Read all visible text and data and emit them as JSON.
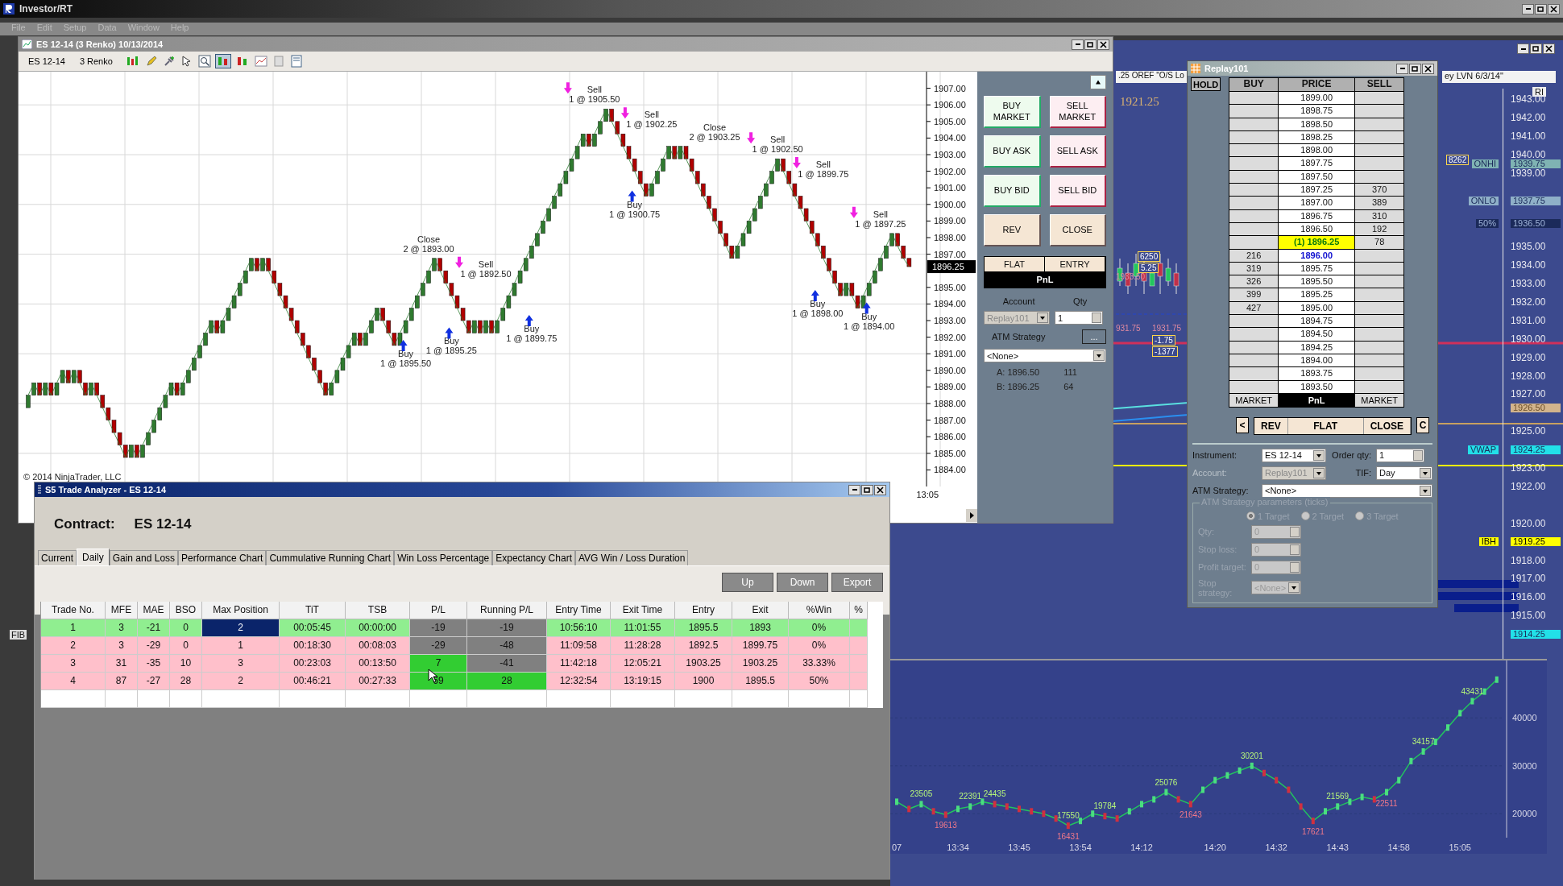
{
  "app": {
    "title": "Investor/RT",
    "menu": [
      "File",
      "Edit",
      "Setup",
      "Data",
      "Window",
      "Help"
    ],
    "side_label": "FIB"
  },
  "chart_window": {
    "title": "ES 12-14 (3 Renko)  10/13/2014",
    "instrument": "ES 12-14",
    "period": "3 Renko",
    "copyright": "© 2014 NinjaTrader, LLC",
    "time_label": "13:05",
    "last_price": "1896.25",
    "chart_data": {
      "type": "line",
      "ylim": [
        1883,
        1908
      ],
      "grid": true,
      "yticks": [
        {
          "value": 1907,
          "label": "1907.00"
        },
        {
          "value": 1906,
          "label": "1906.00"
        },
        {
          "value": 1905,
          "label": "1905.00"
        },
        {
          "value": 1904,
          "label": "1904.00"
        },
        {
          "value": 1903,
          "label": "1903.00"
        },
        {
          "value": 1902,
          "label": "1902.00"
        },
        {
          "value": 1901,
          "label": "1901.00"
        },
        {
          "value": 1900,
          "label": "1900.00"
        },
        {
          "value": 1899,
          "label": "1899.00"
        },
        {
          "value": 1898,
          "label": "1898.00"
        },
        {
          "value": 1897,
          "label": "1897.00"
        },
        {
          "value": 1895,
          "label": "1895.00"
        },
        {
          "value": 1894,
          "label": "1894.00"
        },
        {
          "value": 1893,
          "label": "1893.00"
        },
        {
          "value": 1892,
          "label": "1892.00"
        },
        {
          "value": 1891,
          "label": "1891.00"
        },
        {
          "value": 1890,
          "label": "1890.00"
        },
        {
          "value": 1889,
          "label": "1889.00"
        },
        {
          "value": 1888,
          "label": "1888.00"
        },
        {
          "value": 1887,
          "label": "1887.00"
        },
        {
          "value": 1886,
          "label": "1886.00"
        },
        {
          "value": 1885,
          "label": "1885.00"
        },
        {
          "value": 1884,
          "label": "1884.00"
        }
      ],
      "series": [
        {
          "color": "#2e7d32",
          "values": [
            1888.5,
            1889.25,
            1888.5,
            1889.25,
            1888.5,
            1889.25,
            1890,
            1889.25,
            1890,
            1889.25,
            1888.5,
            1889.25,
            1888.5,
            1887.75,
            1887,
            1886.25,
            1885.5,
            1884.75,
            1885.5,
            1884.75,
            1885.5,
            1886.25,
            1887,
            1887.75,
            1888.5,
            1889.25,
            1888.5,
            1889.25,
            1890,
            1890.75,
            1891.5,
            1892.25,
            1893,
            1892.25,
            1893,
            1893.75,
            1894.5,
            1895.25,
            1896,
            1896.75,
            1896,
            1896.75,
            1896,
            1895.25,
            1894.5,
            1893.75,
            1893,
            1892.25,
            1891.5,
            1890.75,
            1890,
            1889.25,
            1888.5,
            1889.25,
            1890,
            1890.75,
            1891.5,
            1892.25,
            1891.5,
            1892.25,
            1893,
            1893.75,
            1893,
            1892.25,
            1891.5,
            1892.25,
            1893,
            1893.75,
            1894.5,
            1895.25,
            1896,
            1896.75,
            1896,
            1895.25,
            1894.5,
            1893.75,
            1893,
            1892.25,
            1893,
            1892.25,
            1893,
            1892.25,
            1893,
            1893.75,
            1894.5,
            1895.25,
            1896,
            1896.75,
            1897.5,
            1898.25,
            1899,
            1899.75,
            1900.5,
            1901.25,
            1902,
            1902.75,
            1903.5,
            1904.25,
            1903.5,
            1904.25,
            1905,
            1905.75,
            1905,
            1904.25,
            1903.5,
            1902.75,
            1902,
            1901.25,
            1900.5,
            1901.25,
            1902,
            1902.75,
            1903.5,
            1902.75,
            1903.5,
            1902.75,
            1902,
            1901.25,
            1900.5,
            1899.75,
            1899,
            1898.25,
            1897.5,
            1896.75,
            1897.5,
            1898.25,
            1899,
            1899.75,
            1900.5,
            1901.25,
            1902,
            1902.75,
            1902,
            1901.25,
            1900.5,
            1899.75,
            1899,
            1898.25,
            1897.5,
            1896.75,
            1896,
            1895.25,
            1894.5,
            1895.25,
            1894.5,
            1893.75,
            1894.5,
            1895.25,
            1896,
            1896.75,
            1897.5,
            1898.25,
            1897.5,
            1896.75,
            1896.25
          ]
        }
      ],
      "annotations": [
        "Close",
        "2 @ 1893.00",
        "Sell",
        "1 @ 1892.50",
        "Buy",
        "1 @ 1895.50",
        "Buy",
        "1 @ 1895.25",
        "Buy",
        "1 @ 1899.75",
        "Sell",
        "1 @ 1905.50",
        "Sell",
        "1 @ 1902.25",
        "Buy",
        "1 @ 1900.75",
        "Close",
        "2 @ 1903.25",
        "Sell",
        "1 @ 1902.50",
        "Sell",
        "1 @ 1899.75",
        "Sell",
        "1 @ 1897.25",
        "Buy",
        "1 @ 1898.00",
        "Buy",
        "1 @ 1894.00"
      ]
    }
  },
  "order_panel": {
    "buttons": [
      {
        "label": "BUY MARKET",
        "kind": "buy"
      },
      {
        "label": "SELL MARKET",
        "kind": "sell"
      },
      {
        "label": "BUY ASK",
        "kind": "buy"
      },
      {
        "label": "SELL ASK",
        "kind": "sell"
      },
      {
        "label": "BUY BID",
        "kind": "buy"
      },
      {
        "label": "SELL BID",
        "kind": "sell"
      },
      {
        "label": "REV",
        "kind": "neutral"
      },
      {
        "label": "CLOSE",
        "kind": "neutral"
      }
    ],
    "position": [
      "FLAT",
      "ENTRY"
    ],
    "pnl": "PnL",
    "account_label": "Account",
    "qty_label": "Qty",
    "account": {
      "value": "Replay101",
      "disabled": true
    },
    "qty": "1",
    "atm_label": "ATM Strategy",
    "atm_button": "...",
    "atm_value": "<None>",
    "quotes": [
      {
        "label": "A: 1896.50",
        "size": "111"
      },
      {
        "label": "B: 1896.25",
        "size": "64"
      }
    ]
  },
  "dom": {
    "title": "Replay101",
    "hold": "HOLD",
    "columns": [
      "BUY",
      "PRICE",
      "SELL"
    ],
    "rows": [
      {
        "price": "1899.00",
        "kind": "normal"
      },
      {
        "price": "1898.75",
        "kind": "normal"
      },
      {
        "price": "1898.50",
        "kind": "normal"
      },
      {
        "price": "1898.25",
        "kind": "normal"
      },
      {
        "price": "1898.00",
        "kind": "normal"
      },
      {
        "price": "1897.75",
        "kind": "normal"
      },
      {
        "price": "1897.50",
        "kind": "normal"
      },
      {
        "price": "1897.25",
        "sell": "370",
        "kind": "normal"
      },
      {
        "price": "1897.00",
        "sell": "389",
        "kind": "normal"
      },
      {
        "price": "1896.75",
        "sell": "310",
        "kind": "normal"
      },
      {
        "price": "1896.50",
        "sell": "192",
        "kind": "normal"
      },
      {
        "price": "(1) 1896.25",
        "sell": "78",
        "kind": "last"
      },
      {
        "price": "1896.00",
        "buy": "216",
        "kind": "bid"
      },
      {
        "price": "1895.75",
        "buy": "319",
        "kind": "normal"
      },
      {
        "price": "1895.50",
        "buy": "326",
        "kind": "normal"
      },
      {
        "price": "1895.25",
        "buy": "399",
        "kind": "normal"
      },
      {
        "price": "1895.00",
        "buy": "427",
        "kind": "normal"
      },
      {
        "price": "1894.75",
        "kind": "normal"
      },
      {
        "price": "1894.50",
        "kind": "normal"
      },
      {
        "price": "1894.25",
        "kind": "normal"
      },
      {
        "price": "1894.00",
        "kind": "normal"
      },
      {
        "price": "1893.75",
        "kind": "normal"
      },
      {
        "price": "1893.50",
        "kind": "normal"
      }
    ],
    "footer": [
      "MARKET",
      "PnL",
      "MARKET"
    ],
    "actions": [
      "<",
      "REV",
      "FLAT",
      "CLOSE",
      "C"
    ],
    "instrument": {
      "label": "Instrument:",
      "value": "ES 12-14",
      "disabled": false
    },
    "order_qty": {
      "label": "Order qty:",
      "value": "1",
      "disabled": false
    },
    "account": {
      "label": "Account:",
      "value": "Replay101",
      "disabled": true
    },
    "tif": {
      "label": "TIF:",
      "value": "Day",
      "disabled": false
    },
    "atm": {
      "label": "ATM Strategy:",
      "value": "<None>",
      "disabled": false
    },
    "params": {
      "legend": "ATM Strategy parameters (ticks)",
      "disabled": true,
      "targets": [
        {
          "label": "1 Target",
          "selected": true
        },
        {
          "label": "2 Target",
          "selected": false
        },
        {
          "label": "3 Target",
          "selected": false
        }
      ],
      "fields": [
        {
          "label": "Qty:",
          "value": "0",
          "kind": "spinner"
        },
        {
          "label": "Stop loss:",
          "value": "0",
          "kind": "spinner"
        },
        {
          "label": "Profit target:",
          "value": "0",
          "kind": "spinner"
        },
        {
          "label": "Stop strategy:",
          "value": "<None>",
          "kind": "dropdown"
        }
      ]
    }
  },
  "analyzer": {
    "title": "S5 Trade Analyzer - ES 12-14",
    "contract_label": "Contract:",
    "contract": "ES 12-14",
    "tabs": [
      {
        "label": "Current",
        "selected": false
      },
      {
        "label": "Daily",
        "selected": true
      },
      {
        "label": "Gain and Loss",
        "selected": false
      },
      {
        "label": "Performance Chart",
        "selected": false
      },
      {
        "label": "Cummulative Running Chart",
        "selected": false
      },
      {
        "label": "Win Loss Percentage",
        "selected": false
      },
      {
        "label": "Expectancy Chart",
        "selected": false
      },
      {
        "label": "AVG Win / Loss Duration",
        "selected": false
      }
    ],
    "buttons": [
      "Up",
      "Down",
      "Export"
    ],
    "columns": [
      "Trade No.",
      "MFE",
      "MAE",
      "BSO",
      "Max Position",
      "TiT",
      "TSB",
      "P/L",
      "Running P/L",
      "Entry Time",
      "Exit Time",
      "Entry",
      "Exit",
      "%Win",
      "%"
    ],
    "rows": [
      {
        "win": true,
        "pl_up": false,
        "running_up": false,
        "selected": true,
        "cells": [
          "1",
          "3",
          "-21",
          "0",
          "2",
          "00:05:45",
          "00:00:00",
          "-19",
          "-19",
          "10:56:10",
          "11:01:55",
          "1895.5",
          "1893",
          "0%"
        ]
      },
      {
        "win": false,
        "pl_up": false,
        "running_up": false,
        "selected": false,
        "cells": [
          "2",
          "3",
          "-29",
          "0",
          "1",
          "00:18:30",
          "00:08:03",
          "-29",
          "-48",
          "11:09:58",
          "11:28:28",
          "1892.5",
          "1899.75",
          "0%"
        ]
      },
      {
        "win": false,
        "pl_up": true,
        "running_up": false,
        "selected": false,
        "cells": [
          "3",
          "31",
          "-35",
          "10",
          "3",
          "00:23:03",
          "00:13:50",
          "7",
          "-41",
          "11:42:18",
          "12:05:21",
          "1903.25",
          "1903.25",
          "33.33%"
        ]
      },
      {
        "win": false,
        "pl_up": true,
        "running_up": true,
        "selected": false,
        "cells": [
          "4",
          "87",
          "-27",
          "28",
          "2",
          "00:46:21",
          "00:27:33",
          "69",
          "28",
          "12:32:54",
          "13:19:15",
          "1900",
          "1895.5",
          "50%"
        ]
      }
    ]
  },
  "right_chart": {
    "header_left": ".25 OREF \"O/S Lo",
    "header_right": "ey LVN 6/3/14\"",
    "big_price": "1921.25",
    "corner": "RI",
    "ticks": [
      "1943.00",
      "1942.00",
      "1941.00",
      "1940.00",
      "1939.00",
      "1935.00",
      "1934.00",
      "1933.00",
      "1932.00",
      "1931.00",
      "1930.00",
      "1929.00",
      "1928.00",
      "1927.00",
      "1925.00",
      "1923.00",
      "1922.00",
      "1920.00",
      "1918.00",
      "1917.00",
      "1916.00",
      "1915.00"
    ],
    "tags": [
      {
        "label": "ONHI",
        "price": "1939.75",
        "kind": "onhi"
      },
      {
        "label": "ONLO",
        "price": "1937.75",
        "kind": "onlo"
      },
      {
        "label": "50%",
        "price": "1936.50",
        "kind": "mid"
      },
      {
        "price": "1926.50",
        "kind": "level"
      },
      {
        "label": "VWAP",
        "price": "1924.25",
        "kind": "vwap"
      },
      {
        "label": "IBH",
        "price": "1919.25",
        "kind": "ibh"
      },
      {
        "price": "1914.25",
        "kind": "vwap"
      }
    ],
    "strip_notes": [
      {
        "text": "6250",
        "boxed": true
      },
      {
        "text": "5.25",
        "boxed": true
      },
      {
        "text": "1933.50",
        "boxed": false
      },
      {
        "text": "931.75",
        "boxed": false
      },
      {
        "text": "1931.75",
        "boxed": false
      },
      {
        "text": "-1.75",
        "boxed": true
      },
      {
        "text": "-1377",
        "boxed": true
      },
      {
        "text": "8262",
        "boxed": true
      }
    ]
  },
  "bottom_chart": {
    "chart_data": {
      "type": "line",
      "ylim": [
        15000,
        52000
      ],
      "grid": true,
      "marker": true,
      "yticks": [
        {
          "value": 20000,
          "label": "20000"
        },
        {
          "value": 30000,
          "label": "30000"
        },
        {
          "value": 40000,
          "label": "40000"
        }
      ],
      "categories": [
        "07",
        null,
        null,
        null,
        null,
        "13:34",
        null,
        null,
        null,
        null,
        "13:45",
        null,
        null,
        null,
        null,
        "13:54",
        null,
        null,
        null,
        null,
        "14:12",
        null,
        null,
        null,
        null,
        null,
        "14:20",
        null,
        null,
        null,
        null,
        "14:32",
        null,
        null,
        null,
        null,
        "14:43",
        null,
        null,
        null,
        null,
        "14:58",
        null,
        null,
        null,
        null,
        "15:05",
        null,
        null,
        null
      ],
      "series": [
        {
          "color": "#22c55e",
          "values": [
            22500,
            21000,
            22000,
            20500,
            19800,
            21000,
            21500,
            22500,
            22000,
            21500,
            21000,
            20500,
            20000,
            19000,
            17500,
            18500,
            20000,
            19500,
            19000,
            20500,
            22000,
            23000,
            24500,
            23000,
            22000,
            25000,
            27000,
            28000,
            29000,
            30000,
            28500,
            27000,
            25000,
            21500,
            18500,
            20500,
            21500,
            22500,
            23500,
            23000,
            24500,
            27000,
            31000,
            33000,
            35000,
            38000,
            41000,
            43500,
            45500,
            48000
          ]
        }
      ],
      "annotations": [
        "23505",
        "19613",
        "22391",
        "24435",
        "17550",
        "16431",
        "19784",
        "25076",
        "21643",
        "30201",
        "17621",
        "21569",
        "22511",
        "34157",
        "43431"
      ]
    }
  }
}
